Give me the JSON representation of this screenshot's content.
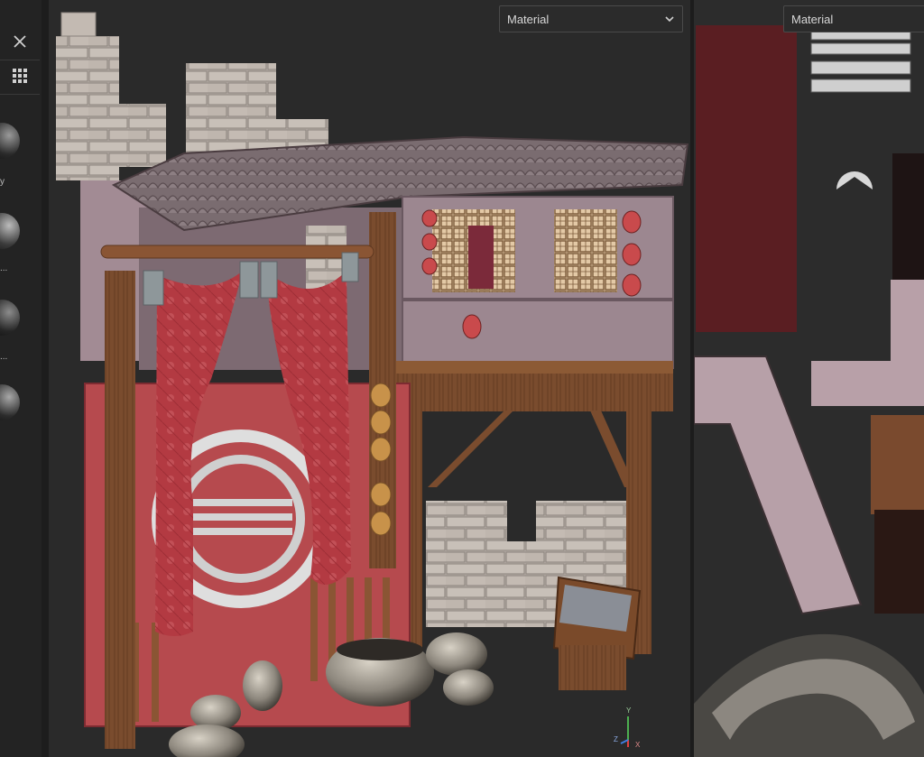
{
  "sidebar": {
    "close_icon": "close-icon",
    "grid_icon": "grid-icon",
    "materials": [
      {
        "label": "y"
      },
      {
        "label": "..."
      },
      {
        "label": "..."
      },
      {
        "label": ""
      }
    ]
  },
  "viewport": {
    "view_mode": {
      "selected": "Material"
    },
    "axis_gizmo": {
      "x": "X",
      "y": "Y",
      "z": "Z"
    }
  },
  "uv_panel": {
    "view_mode": {
      "selected": "Material"
    }
  },
  "colors": {
    "background": "#2a2a2a",
    "sidebar": "#232323",
    "accent_red": "#b84449",
    "wood": "#6e4328"
  }
}
